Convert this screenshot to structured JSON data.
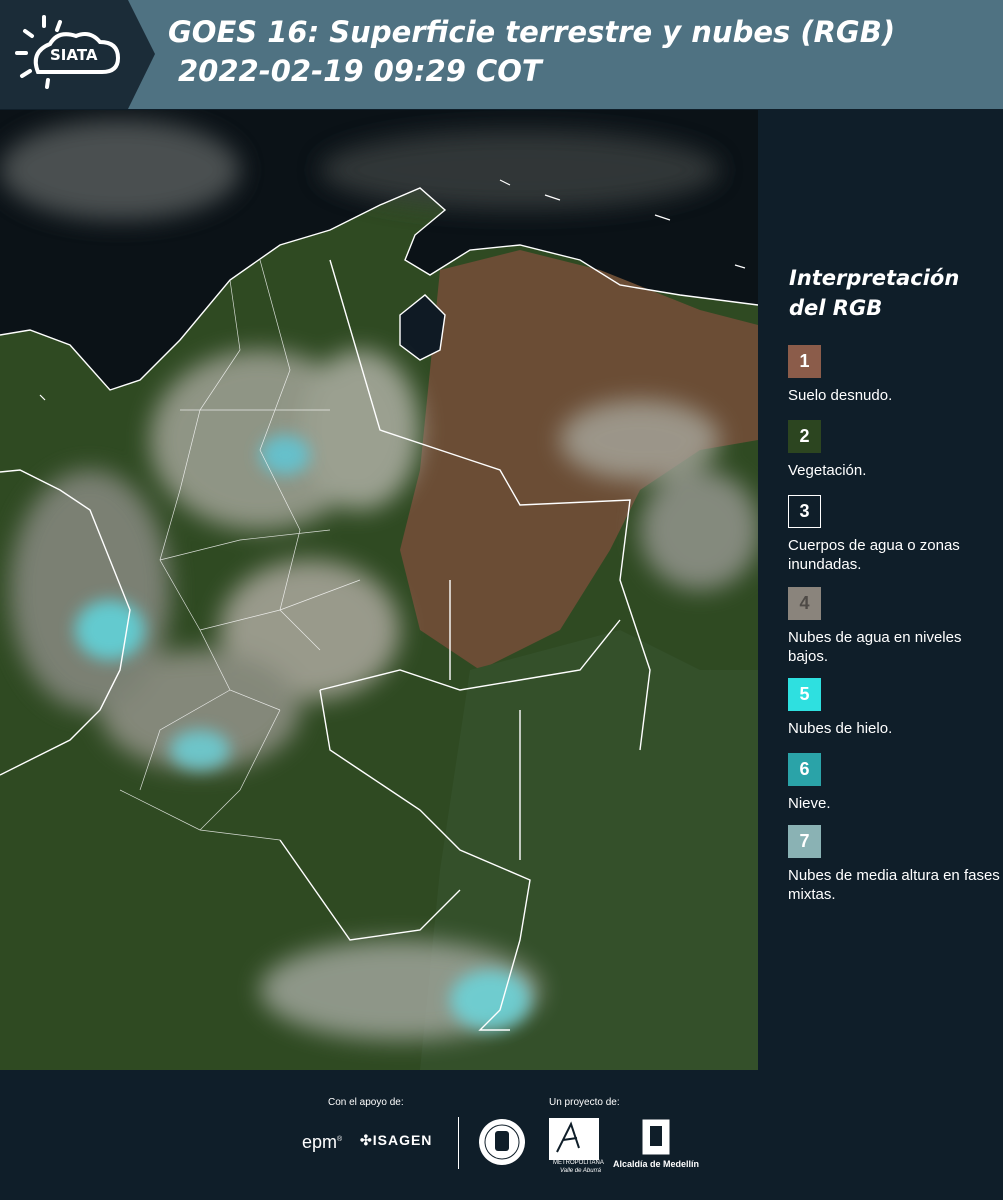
{
  "header": {
    "logo_text": "SIATA",
    "title_line1": "GOES 16: Superficie terrestre y nubes (RGB)",
    "title_line2": "2022-02-19 09:29 COT",
    "background_color": "#4f7282"
  },
  "legend": {
    "title": "Interpretación del RGB",
    "items": [
      {
        "number": "1",
        "label": "Suelo desnudo.",
        "color": "#8b5c4a"
      },
      {
        "number": "2",
        "label": "Vegetación.",
        "color": "#2c4520"
      },
      {
        "number": "3",
        "label": "Cuerpos de agua o zonas inundadas.",
        "color": "#0f1e29"
      },
      {
        "number": "4",
        "label": "Nubes de agua en niveles bajos.",
        "color": "#8a847c"
      },
      {
        "number": "5",
        "label": "Nubes de hielo.",
        "color": "#2ee0e0"
      },
      {
        "number": "6",
        "label": "Nieve.",
        "color": "#2aa3a8"
      },
      {
        "number": "7",
        "label": "Nubes de media altura en fases mixtas.",
        "color": "#8ab2b4"
      }
    ]
  },
  "footer": {
    "support_label": "Con el apoyo de:",
    "project_label": "Un proyecto de:",
    "epm": "epm",
    "isagen": "ISAGEN",
    "area_name": "METROPOLITANA",
    "area_sub": "Valle de Aburrá",
    "alcaldia": "Alcaldía de Medellín"
  }
}
